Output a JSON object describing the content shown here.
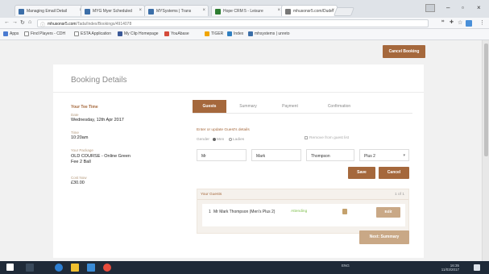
{
  "browser": {
    "tabs": [
      {
        "label": "Managing Email Detail",
        "color": "#3b6ea8"
      },
      {
        "label": "MYG Myer Scheduled",
        "color": "#3b6ea8"
      },
      {
        "label": "MYSystems | Trans",
        "color": "#3b6ea8"
      },
      {
        "label": "Hope CRM 5 - Leisure",
        "color": "#2e7d32"
      },
      {
        "label": "mhusonsr5.com/Dude/",
        "color": "#777777"
      }
    ],
    "url_prefix": "mhusonsr5.com",
    "url_rest": "/Tada/Index/Bookings/4914078",
    "bookmarks": [
      {
        "label": "Apps",
        "color": "#4a7bd1"
      },
      {
        "label": "Find Players - CDH",
        "color": "#888888"
      },
      {
        "label": "ESTA Application",
        "color": "#888888"
      },
      {
        "label": "My Clip Homepage",
        "color": "#3b5998"
      },
      {
        "label": "YouAbase",
        "color": "#d44b3b"
      },
      {
        "label": "TIGER",
        "color": "#f0a500"
      },
      {
        "label": "Index",
        "color": "#2f7fc1"
      },
      {
        "label": "mhsystems | unreto",
        "color": "#3b6ea8"
      }
    ]
  },
  "header": {
    "cancel_booking_label": "Cancel Booking"
  },
  "card": {
    "title": "Booking Details",
    "tee_time_heading": "Your Tee Time",
    "date_label": "Date",
    "date_value": "Wednesday, 12th Apr 2017",
    "time_label": "Time",
    "time_value": "10:20am",
    "package_label": "Your Package",
    "package_value": "OLD COURSE - Online Green Fee 2 Ball",
    "cost_label": "Cost Now",
    "cost_value": "£30.00"
  },
  "steps": [
    {
      "label": "Guests",
      "active": true
    },
    {
      "label": "Summary",
      "active": false
    },
    {
      "label": "Payment",
      "active": false
    },
    {
      "label": "Confirmation",
      "active": false
    }
  ],
  "form": {
    "hint": "Enter or update Guest's details",
    "gender_label": "Gender",
    "gender_men": "Men",
    "gender_ladies": "Ladies",
    "remove_label": "Remove from guest list",
    "title_value": "Mr",
    "first_value": "Mark",
    "last_value": "Thompson",
    "plus_value": "Plus 2",
    "save_label": "Save",
    "cancel_label": "Cancel"
  },
  "guests": {
    "heading": "Your Guests",
    "count": "1 of 1",
    "rows": [
      {
        "num": "1",
        "name": "Mr Mark Thompson (Men's Plus 2)",
        "status": "Attending",
        "edit": "Edit"
      }
    ]
  },
  "next_label": "Next: Summary",
  "taskbar": {
    "lang": "ENG",
    "time": "16:35",
    "date": "11/03/2017"
  }
}
